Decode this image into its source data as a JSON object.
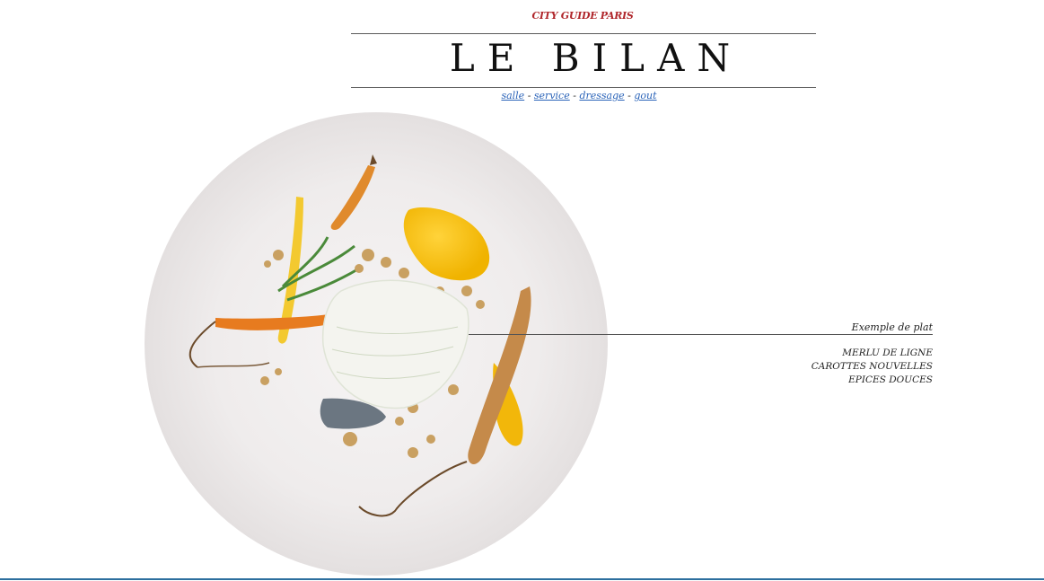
{
  "header": {
    "kicker": "CITY GUIDE PARIS",
    "title": "LE BILAN"
  },
  "nav": {
    "items": [
      {
        "label": "salle"
      },
      {
        "label": "service"
      },
      {
        "label": "dressage"
      },
      {
        "label": "gout"
      }
    ],
    "separator": "-"
  },
  "dish": {
    "label": "Exemple de plat",
    "items": [
      "MERLU DE LIGNE",
      "CAROTTES NOUVELLES",
      "EPICES DOUCES"
    ]
  },
  "colors": {
    "kicker": "#b0262b",
    "link": "#2a63b8",
    "bottom_line": "#2d6f9e"
  }
}
